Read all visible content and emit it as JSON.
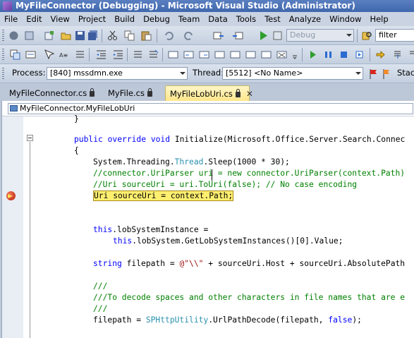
{
  "window": {
    "title": "MyFileConnector (Debugging) - Microsoft Visual Studio (Administrator)"
  },
  "menu": [
    "File",
    "Edit",
    "View",
    "Project",
    "Build",
    "Debug",
    "Team",
    "Data",
    "Tools",
    "Test",
    "Analyze",
    "Window",
    "Help"
  ],
  "toolbar1": {
    "config_value": "Debug",
    "find_value": "filter"
  },
  "debug_location": {
    "process_label": "Process:",
    "process_value": "[840] mssdmn.exe",
    "thread_label": "Thread:",
    "thread_value": "[5512] <No Name>",
    "stack_label": "Stac"
  },
  "tabs": [
    {
      "label": "MyFileConnector.cs"
    },
    {
      "label": "MyFile.cs"
    },
    {
      "label": "MyFileLobUri.cs"
    }
  ],
  "nav": {
    "class_value": "MyFileConnector.MyFileLobUri"
  },
  "code": {
    "l0": "}",
    "l1_kw": "public override void ",
    "l1_rest": "Initialize(Microsoft.Office.Server.Search.Connec",
    "l2": "{",
    "l3_a": "System.Threading.",
    "l3_type": "Thread",
    "l3_b": ".Sleep(1000 * 30);",
    "l4": "//connector.UriParser uri = new connector.UriParser(context.Path)",
    "l5": "//Uri sourceUri = uri.ToUri(false); // No case encoding",
    "l6": "Uri sourceUri = context.Path;",
    "l9_kw": "this",
    ".l9_rest": "",
    "l9_rest": ".lobSystemInstance =",
    "l10_kw": "this",
    "l10_rest": ".lobSystem.GetLobSystemInstances()[0].Value;",
    "l12_kw": "string",
    "l12_a": " filepath = ",
    "l12_str": "@\"\\\\\"",
    "l12_b": " + sourceUri.Host + sourceUri.AbsolutePath",
    "l14": "///",
    "l15": "///To decode spaces and other characters in file names that are e",
    "l16": "///",
    "l17_a": "filepath = ",
    "l17_type": "SPHttpUtility",
    "l17_b": ".UrlPathDecode(filepath, ",
    "l17_kw": "false",
    "l17_c": ");"
  }
}
